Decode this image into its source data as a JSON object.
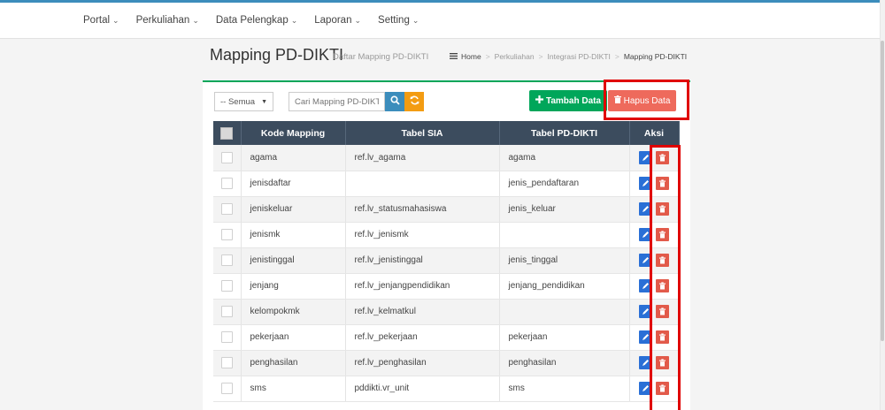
{
  "nav": {
    "items": [
      {
        "label": "Portal",
        "caret": "⌄"
      },
      {
        "label": "Perkuliahan",
        "caret": "⌄"
      },
      {
        "label": "Data Pelengkap",
        "caret": "⌄"
      },
      {
        "label": "Laporan",
        "caret": "⌄"
      },
      {
        "label": "Setting",
        "caret": "⌄"
      }
    ]
  },
  "header": {
    "title": "Mapping PD-DIKTI",
    "subtitle": "Daftar Mapping PD-DIKTI"
  },
  "breadcrumb": {
    "home_icon": "menu-icon",
    "items": [
      "Home",
      "Perkuliahan",
      "Integrasi PD-DIKTI",
      "Mapping PD-DIKTI"
    ],
    "separator": ">"
  },
  "toolbar": {
    "filter_value": "-- Semua",
    "search_placeholder": "Cari Mapping PD-DIKTI",
    "add_label": "Tambah Data",
    "delete_label": "Hapus Data",
    "add_icon": "plus-icon",
    "delete_icon": "trash-icon"
  },
  "table": {
    "columns": [
      "Kode Mapping",
      "Tabel SIA",
      "Tabel PD-DIKTI",
      "Aksi"
    ],
    "rows": [
      {
        "kode": "agama",
        "sia": "ref.lv_agama",
        "dikti": "agama"
      },
      {
        "kode": "jenisdaftar",
        "sia": "",
        "dikti": "jenis_pendaftaran"
      },
      {
        "kode": "jeniskeluar",
        "sia": "ref.lv_statusmahasiswa",
        "dikti": "jenis_keluar"
      },
      {
        "kode": "jenismk",
        "sia": "ref.lv_jenismk",
        "dikti": ""
      },
      {
        "kode": "jenistinggal",
        "sia": "ref.lv_jenistinggal",
        "dikti": "jenis_tinggal"
      },
      {
        "kode": "jenjang",
        "sia": "ref.lv_jenjangpendidikan",
        "dikti": "jenjang_pendidikan"
      },
      {
        "kode": "kelompokmk",
        "sia": "ref.lv_kelmatkul",
        "dikti": ""
      },
      {
        "kode": "pekerjaan",
        "sia": "ref.lv_pekerjaan",
        "dikti": "pekerjaan"
      },
      {
        "kode": "penghasilan",
        "sia": "ref.lv_penghasilan",
        "dikti": "penghasilan"
      },
      {
        "kode": "sms",
        "sia": "pddikti.vr_unit",
        "dikti": "sms"
      }
    ]
  },
  "colors": {
    "primary": "#3c8dbc",
    "success": "#00a65a",
    "danger": "#ee6a5c",
    "warning": "#f39c12",
    "table_header": "#3c4c5e",
    "highlight": "#e00000"
  }
}
